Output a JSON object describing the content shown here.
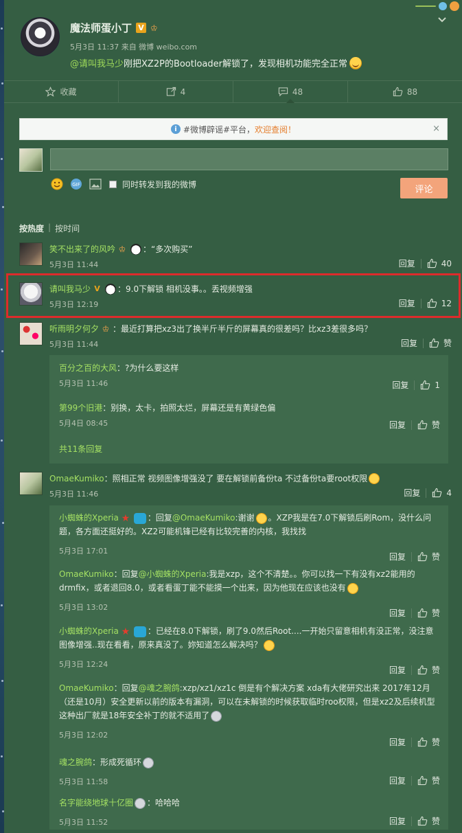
{
  "post": {
    "author": "魔法师蛋小丁",
    "badge_v": "V",
    "meta": "5月3日 11:37 来自 微博 weibo.com",
    "mention": "@请叫我马少",
    "text": " 刚把XZ2P的Bootloader解锁了，发现相机功能完全正常"
  },
  "actions": {
    "favorite": "收藏",
    "repost": "4",
    "comment": "48",
    "like": "88"
  },
  "notice": {
    "text": "#微博辟谣#平台，",
    "link": "欢迎查阅！",
    "close": "×"
  },
  "compose": {
    "repost_label": "同时转发到我的微博",
    "submit": "评论"
  },
  "sort": {
    "hot": "按热度",
    "time": "按时间"
  },
  "reply_label": "回复",
  "like_zan": "赞",
  "comments": [
    {
      "name": "笑不出来了的风吟",
      "text": "：“多次购买”",
      "time": "5月3日 11:44",
      "likes": "40"
    },
    {
      "name": "请叫我马少",
      "badge": "V",
      "text": "：9.0下解锁 相机没事。。丢视频增强",
      "time": "5月3日 12:19",
      "likes": "12"
    },
    {
      "name": "听雨明夕何夕",
      "text": "：最近打算把xz3出了换半斤半斤的屏幕真的很差吗？比xz3差很多吗？",
      "time": "5月3日 11:44",
      "likes": "赞"
    },
    {
      "name": "OmaeKumiko",
      "text": "：照相正常 视频图像增强没了 要在解锁前备份ta 不过备份ta要root权限",
      "time": "5月3日 11:46",
      "likes": "4"
    }
  ],
  "replies_a": [
    {
      "name": "百分之百的大风",
      "text": "：?为什么要这样",
      "time": "5月3日 11:46",
      "likes": "1"
    },
    {
      "name": "第99个旧港",
      "text": "：别换，太卡，拍照太烂，屏幕还是有黄绿色偏",
      "time": "5月4日 08:45",
      "likes": "赞"
    }
  ],
  "replies_a_more": "共11条回复",
  "replies_b": [
    {
      "name": "小蜘蛛的Xperia",
      "pre": "：回复",
      "mention": "@OmaeKumiko",
      "text1": ":谢谢",
      "text2": "。XZP我是在7.0下解锁后刷Rom，没什么问题，各方面还挺好的。XZ2可能机锋已经有比较完善的内核，我找找",
      "time": "5月3日 17:01",
      "likes": "赞"
    },
    {
      "name": "OmaeKumiko",
      "pre": "：回复",
      "mention": "@小蜘蛛的Xperia",
      "text1": ":我是xzp，这个不清楚。。你可以找一下有没有xz2能用的drmfix，或者退回8.0，或者看蛋丁能不能摸一个出来，因为他现在应该也没有",
      "text2": "",
      "time": "5月3日 13:02",
      "likes": "赞"
    },
    {
      "name": "小蜘蛛的Xperia",
      "pre": "",
      "mention": "",
      "text1": "：已经在8.0下解锁，刷了9.0然后Root....一开始只留意相机有没正常，没注意图像增强..现在看看，原来真没了。妳知道怎么解决吗？",
      "text2": "",
      "time": "5月3日 12:24",
      "likes": "赞"
    },
    {
      "name": "OmaeKumiko",
      "pre": "：回复",
      "mention": "@魂之腕鸽",
      "text1": ":xzp/xz1/xz1c 倒是有个解决方案 xda有大佬研究出来 2017年12月（还是10月）安全更新以前的版本有漏洞，可以在未解锁的时候获取临时roo权限，但是xz2及后续机型这种出厂就是18年安全补丁的就不适用了",
      "text2": "",
      "time": "5月3日 12:02",
      "likes": "赞"
    },
    {
      "name": "魂之腕鸽",
      "pre": "",
      "mention": "",
      "text1": "：形成死循环",
      "text2": "",
      "time": "5月3日 11:58",
      "likes": "赞"
    },
    {
      "name": "名字能绕地球十亿圈",
      "pre": "",
      "mention": "",
      "text1": "：哈哈哈",
      "text2": "",
      "time": "5月3日 11:52",
      "likes": "赞"
    }
  ]
}
